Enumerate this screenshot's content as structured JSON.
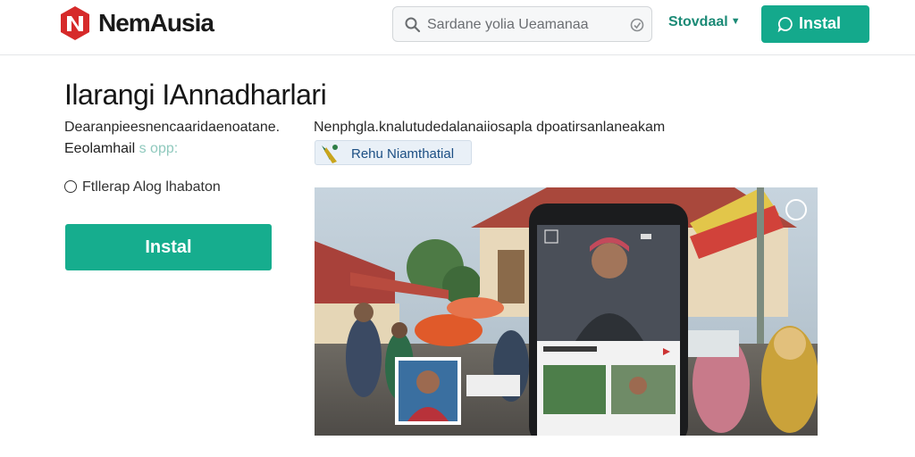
{
  "header": {
    "brand": "NemAusia",
    "search_placeholder": "Sardane yolia Ueamanaa",
    "store_menu": "Stovdaal",
    "install_label": "Instal"
  },
  "app": {
    "title": "Ilarangi IAnnadharlari",
    "description": "Dearanpieesnencaaridaenoatane.",
    "publisher": "Eeolamhail",
    "publisher_suffix": "s opp:",
    "rating_text": "Ftllerap Alog lhabaton",
    "install_label": "Instal",
    "subtitle": "Nenphgla.knalutudedalanaiiosapla dpoatirsanlaneakam",
    "chip_label": "Rehu Niamthatial"
  },
  "icons": {
    "logo": "brand-logo-icon",
    "search": "search-icon",
    "mic": "microphone-icon",
    "chevron": "chevron-down-icon",
    "install": "chat-bubble-icon",
    "chip": "app-icon",
    "rating": "circle-icon",
    "screenshot_control": "circle-button-icon"
  },
  "colors": {
    "accent": "#14a98c",
    "brand_red": "#d62a2a",
    "link": "#1b8a76",
    "chip_text": "#1c4f84"
  }
}
